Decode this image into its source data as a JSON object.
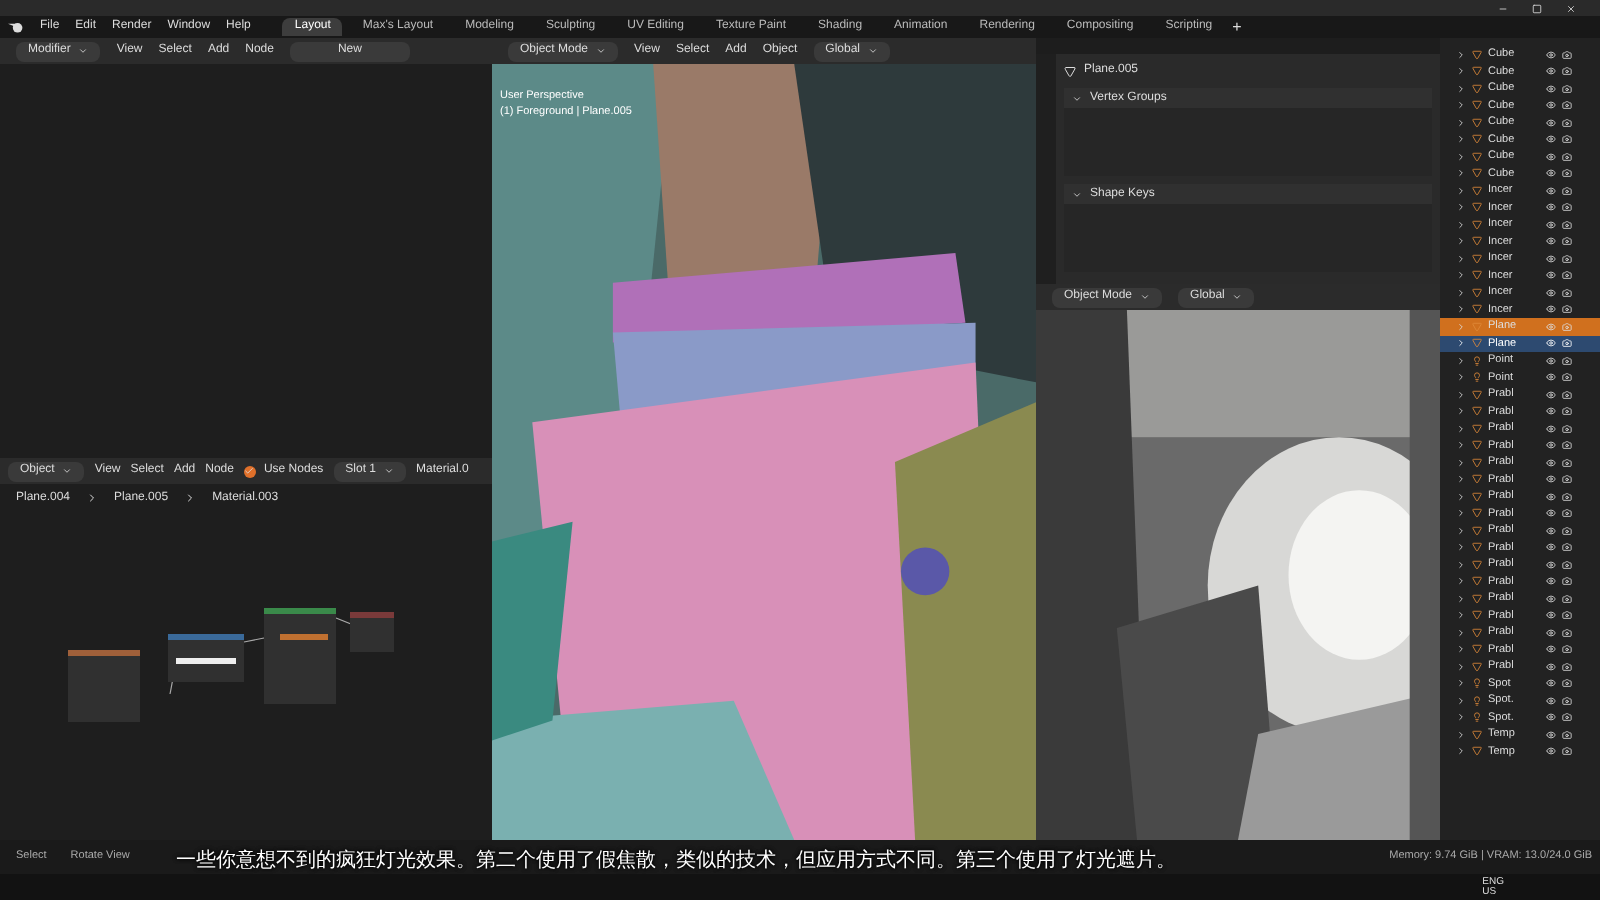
{
  "menu": [
    "File",
    "Edit",
    "Render",
    "Window",
    "Help"
  ],
  "workspaces": [
    {
      "label": "Layout",
      "selected": true
    },
    {
      "label": "Max's Layout",
      "selected": false
    },
    {
      "label": "Modeling",
      "selected": false
    },
    {
      "label": "Sculpting",
      "selected": false
    },
    {
      "label": "UV Editing",
      "selected": false
    },
    {
      "label": "Texture Paint",
      "selected": false
    },
    {
      "label": "Shading",
      "selected": false
    },
    {
      "label": "Animation",
      "selected": false
    },
    {
      "label": "Rendering",
      "selected": false
    },
    {
      "label": "Compositing",
      "selected": false
    },
    {
      "label": "Scripting",
      "selected": false
    }
  ],
  "add_workspace": "+",
  "node_header": {
    "mode": "Modifier",
    "menus": [
      "View",
      "Select",
      "Add",
      "Node"
    ],
    "new_button": "New"
  },
  "viewport_header": {
    "mode": "Object Mode",
    "menus": [
      "View",
      "Select",
      "Add",
      "Object"
    ],
    "orientation": "Global"
  },
  "viewport_overlay": [
    "User Perspective",
    "(1) Foreground | Plane.005"
  ],
  "shader_header": {
    "type": "Object",
    "menus": [
      "View",
      "Select",
      "Add",
      "Node"
    ],
    "use_nodes": {
      "label": "Use Nodes",
      "checked": true
    },
    "slot": "Slot 1",
    "material": "Material.0"
  },
  "breadcrumb": [
    "Plane.004",
    "Plane.005",
    "Material.003"
  ],
  "properties": {
    "object": "Plane.005",
    "panels": [
      {
        "title": "Vertex Groups",
        "expanded": true
      },
      {
        "title": "Shape Keys",
        "expanded": true
      }
    ]
  },
  "render_header": {
    "mode": "Object Mode",
    "orientation": "Global"
  },
  "outliner": [
    {
      "name": "Cube",
      "kind": "mesh",
      "selected": false,
      "active": false
    },
    {
      "name": "Cube",
      "kind": "mesh",
      "selected": false,
      "active": false
    },
    {
      "name": "Cube",
      "kind": "mesh",
      "selected": false,
      "active": false
    },
    {
      "name": "Cube",
      "kind": "mesh",
      "selected": false,
      "active": false
    },
    {
      "name": "Cube",
      "kind": "mesh",
      "selected": false,
      "active": false
    },
    {
      "name": "Cube",
      "kind": "mesh",
      "selected": false,
      "active": false
    },
    {
      "name": "Cube",
      "kind": "mesh",
      "selected": false,
      "active": false
    },
    {
      "name": "Cube",
      "kind": "mesh",
      "selected": false,
      "active": false
    },
    {
      "name": "Incer",
      "kind": "mesh",
      "selected": false,
      "active": false
    },
    {
      "name": "Incer",
      "kind": "mesh",
      "selected": false,
      "active": false
    },
    {
      "name": "Incer",
      "kind": "mesh",
      "selected": false,
      "active": false
    },
    {
      "name": "Incer",
      "kind": "mesh",
      "selected": false,
      "active": false
    },
    {
      "name": "Incer",
      "kind": "mesh",
      "selected": false,
      "active": false
    },
    {
      "name": "Incer",
      "kind": "mesh",
      "selected": false,
      "active": false
    },
    {
      "name": "Incer",
      "kind": "mesh",
      "selected": false,
      "active": false
    },
    {
      "name": "Incer",
      "kind": "mesh",
      "selected": false,
      "active": false
    },
    {
      "name": "Plane",
      "kind": "mesh",
      "selected": true,
      "active": false
    },
    {
      "name": "Plane",
      "kind": "mesh",
      "selected": false,
      "active": true
    },
    {
      "name": "Point",
      "kind": "light",
      "selected": false,
      "active": false
    },
    {
      "name": "Point",
      "kind": "light",
      "selected": false,
      "active": false
    },
    {
      "name": "Prabl",
      "kind": "mesh",
      "selected": false,
      "active": false
    },
    {
      "name": "Prabl",
      "kind": "mesh",
      "selected": false,
      "active": false
    },
    {
      "name": "Prabl",
      "kind": "mesh",
      "selected": false,
      "active": false
    },
    {
      "name": "Prabl",
      "kind": "mesh",
      "selected": false,
      "active": false
    },
    {
      "name": "Prabl",
      "kind": "mesh",
      "selected": false,
      "active": false
    },
    {
      "name": "Prabl",
      "kind": "mesh",
      "selected": false,
      "active": false
    },
    {
      "name": "Prabl",
      "kind": "mesh",
      "selected": false,
      "active": false
    },
    {
      "name": "Prabl",
      "kind": "mesh",
      "selected": false,
      "active": false
    },
    {
      "name": "Prabl",
      "kind": "mesh",
      "selected": false,
      "active": false
    },
    {
      "name": "Prabl",
      "kind": "mesh",
      "selected": false,
      "active": false
    },
    {
      "name": "Prabl",
      "kind": "mesh",
      "selected": false,
      "active": false
    },
    {
      "name": "Prabl",
      "kind": "mesh",
      "selected": false,
      "active": false
    },
    {
      "name": "Prabl",
      "kind": "mesh",
      "selected": false,
      "active": false
    },
    {
      "name": "Prabl",
      "kind": "mesh",
      "selected": false,
      "active": false
    },
    {
      "name": "Prabl",
      "kind": "mesh",
      "selected": false,
      "active": false
    },
    {
      "name": "Prabl",
      "kind": "mesh",
      "selected": false,
      "active": false
    },
    {
      "name": "Prabl",
      "kind": "mesh",
      "selected": false,
      "active": false
    },
    {
      "name": "Spot",
      "kind": "light",
      "selected": false,
      "active": false
    },
    {
      "name": "Spot.",
      "kind": "light",
      "selected": false,
      "active": false
    },
    {
      "name": "Spot.",
      "kind": "light",
      "selected": false,
      "active": false
    },
    {
      "name": "Temp",
      "kind": "mesh",
      "selected": false,
      "active": false
    },
    {
      "name": "Temp",
      "kind": "mesh",
      "selected": false,
      "active": false
    }
  ],
  "status": {
    "items": [
      "Select",
      "Rotate View"
    ],
    "memory": "Memory: 9.74 GiB | VRAM: 13.0/24.0 GiB"
  },
  "subtitle": "一些你意想不到的疯狂灯光效果。第二个使用了假焦散，类似的技术，但应用方式不同。第三个使用了灯光遮片。",
  "taskbar": {
    "language": "ENG",
    "region": "US"
  }
}
